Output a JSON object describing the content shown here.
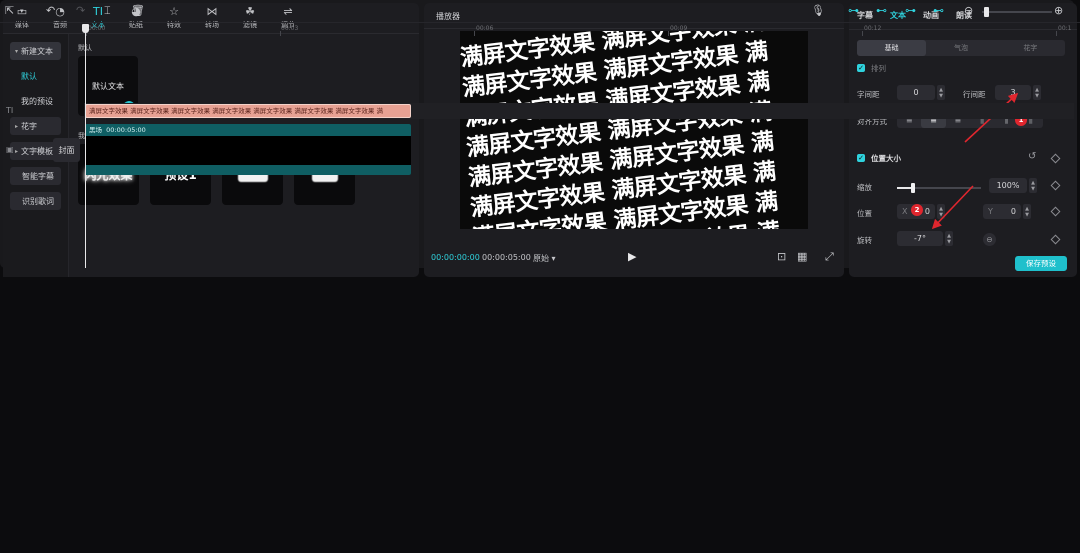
{
  "toolbar": {
    "tabs": [
      {
        "label": "媒体",
        "icon": "▭"
      },
      {
        "label": "音频",
        "icon": "◔"
      },
      {
        "label": "文本",
        "icon": "TI"
      },
      {
        "label": "贴纸",
        "icon": "◕"
      },
      {
        "label": "特效",
        "icon": "☆"
      },
      {
        "label": "转场",
        "icon": "⋈"
      },
      {
        "label": "滤镜",
        "icon": "☘"
      },
      {
        "label": "调节",
        "icon": "⇌"
      }
    ]
  },
  "left_nav": {
    "new_text": "新建文本",
    "default": "默认",
    "my_presets": "我的预设",
    "fancy": "花字",
    "templates": "文字模板",
    "smart_subtitles": "智能字幕",
    "lyrics": "识别歌词"
  },
  "library": {
    "default_section": "默认",
    "default_tile": "默认文本",
    "presets_section": "我的预设",
    "preset1": "闪光效果",
    "preset2": "预设1"
  },
  "player": {
    "title": "播放器",
    "video_lines": [
      "满屏文字效果 满屏文字效果 满",
      "满屏文字效果 满屏文字效果 满",
      "满屏文字效果 满屏文字效果 满",
      "满屏文字效果 满屏文字效果 满",
      "满屏文字效果 满屏文字效果 满",
      "满屏文字效果 满屏文字效果 满",
      "满屏文字效果 满屏文字效果 满",
      "满屏文字效果 满屏文字效果 满"
    ],
    "current_time": "00:00:00:00",
    "total_time": "00:00:05:00",
    "ratio": "原始"
  },
  "properties": {
    "tabs": [
      "字幕",
      "文本",
      "动画",
      "朗读"
    ],
    "segments": [
      "基础",
      "气泡",
      "花字"
    ],
    "arrange_label": "排列",
    "char_spacing_label": "字间距",
    "char_spacing": "0",
    "line_spacing_label": "行间距",
    "line_spacing": "3",
    "align_label": "对齐方式",
    "position_size_label": "位置大小",
    "scale_label": "缩放",
    "scale": "100%",
    "position_label": "位置",
    "x_label": "X",
    "x_value": "0",
    "y_label": "Y",
    "y_value": "0",
    "rotate_label": "旋转",
    "rotate": "-7°",
    "save_preset": "保存预设",
    "marker1": "1",
    "marker2": "2"
  },
  "timeline": {
    "ticks": [
      "00:00",
      "00:03",
      "00:06",
      "00:09",
      "00:12",
      "00:1"
    ],
    "text_clip": "满屏文字效果 满屏文字效果 满屏文字效果 满屏文字效果 满屏文字效果 满屏文字效果 满屏文字效果 满",
    "video_clip_name": "黑场",
    "video_clip_duration": "00:00:05:00",
    "cover": "封面"
  },
  "colors": {
    "accent": "#2fd2dd",
    "text_clip": "#e7a193",
    "video_clip": "#0f5e63",
    "marker": "#e0262e"
  }
}
